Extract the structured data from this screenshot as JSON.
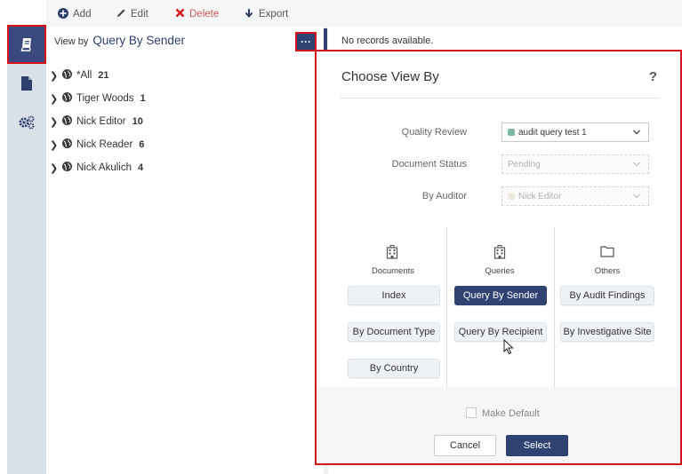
{
  "toolbar": {
    "add_label": "Add",
    "edit_label": "Edit",
    "delete_label": "Delete",
    "export_label": "Export"
  },
  "rail": {
    "items": [
      {
        "icon": "book-icon",
        "active": true
      },
      {
        "icon": "document-icon",
        "active": false
      },
      {
        "icon": "gears-icon",
        "active": false
      }
    ]
  },
  "tree": {
    "view_by_label": "View by",
    "view_by_value": "Query By Sender",
    "more_button": "···",
    "items": [
      {
        "label": "*All",
        "count": "21"
      },
      {
        "label": "Tiger Woods",
        "count": "1"
      },
      {
        "label": "Nick Editor",
        "count": "10"
      },
      {
        "label": "Nick Reader",
        "count": "6"
      },
      {
        "label": "Nick Akulich",
        "count": "4"
      }
    ]
  },
  "main": {
    "no_records": "No records available."
  },
  "dialog": {
    "title": "Choose View By",
    "help": "?",
    "fields": {
      "quality_review": {
        "label": "Quality Review",
        "value": "audit query test 1"
      },
      "document_status": {
        "label": "Document Status",
        "value": "Pending"
      },
      "by_auditor": {
        "label": "By Auditor",
        "value": "Nick Editor"
      }
    },
    "categories": {
      "documents": {
        "label": "Documents",
        "options": [
          "Index",
          "By Document Type",
          "By Country"
        ]
      },
      "queries": {
        "label": "Queries",
        "options": [
          "Query By Sender",
          "Query By Recipient"
        ],
        "selected": "Query By Sender"
      },
      "others": {
        "label": "Others",
        "options": [
          "By Audit Findings",
          "By Investigative Site"
        ]
      }
    },
    "make_default_label": "Make Default",
    "cancel_label": "Cancel",
    "select_label": "Select"
  },
  "colors": {
    "accent": "#2f4272",
    "highlight_border": "#d6141c",
    "delete": "#c95a56",
    "rail_bg": "#d9e0e7"
  }
}
